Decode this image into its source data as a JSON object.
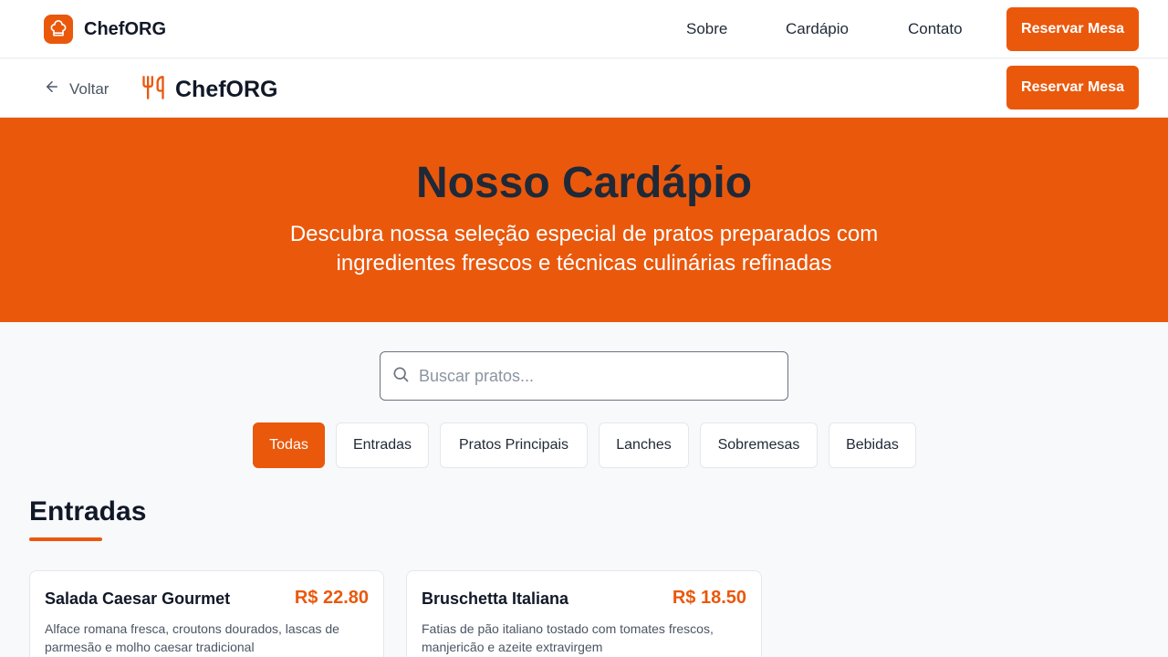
{
  "topnav": {
    "brand": "ChefORG",
    "links": [
      "Sobre",
      "Cardápio",
      "Contato"
    ],
    "reserve_label": "Reservar Mesa"
  },
  "subheader": {
    "back_label": "Voltar",
    "brand": "ChefORG",
    "reserve_label": "Reservar Mesa"
  },
  "hero": {
    "title": "Nosso Cardápio",
    "subtitle": "Descubra nossa seleção especial de pratos preparados com ingredientes frescos e técnicas culinárias refinadas"
  },
  "search": {
    "placeholder": "Buscar pratos...",
    "value": ""
  },
  "filters": [
    {
      "label": "Todas",
      "active": true
    },
    {
      "label": "Entradas",
      "active": false
    },
    {
      "label": "Pratos Principais",
      "active": false
    },
    {
      "label": "Lanches",
      "active": false
    },
    {
      "label": "Sobremesas",
      "active": false
    },
    {
      "label": "Bebidas",
      "active": false
    }
  ],
  "section": {
    "title": "Entradas",
    "items": [
      {
        "name": "Salada Caesar Gourmet",
        "price": "R$ 22.80",
        "description": "Alface romana fresca, croutons dourados, lascas de parmesão e molho caesar tradicional"
      },
      {
        "name": "Bruschetta Italiana",
        "price": "R$ 18.50",
        "description": "Fatias de pão italiano tostado com tomates frescos, manjericão e azeite extravirgem"
      }
    ]
  },
  "colors": {
    "accent": "#ea580c",
    "background": "#f8f9fb",
    "text": "#111827"
  },
  "icons": [
    "chef-hat-icon",
    "arrow-left-icon",
    "utensils-icon",
    "search-icon"
  ]
}
